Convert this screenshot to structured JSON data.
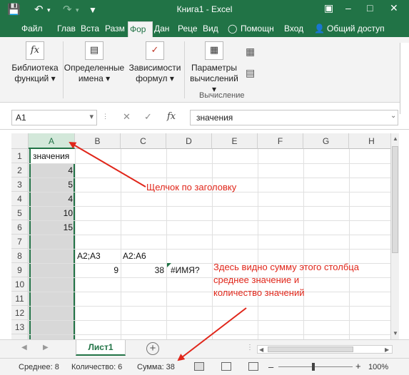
{
  "window": {
    "title": "Книга1 - Excel"
  },
  "tabs": [
    {
      "label": "Файл"
    },
    {
      "label": "Глав"
    },
    {
      "label": "Вста"
    },
    {
      "label": "Разм"
    },
    {
      "label": "Фор"
    },
    {
      "label": "Дан"
    },
    {
      "label": "Реце"
    },
    {
      "label": "Вид"
    }
  ],
  "help": {
    "label": "Помощн"
  },
  "login": {
    "label": "Вход"
  },
  "share": {
    "label": "Общий доступ"
  },
  "ribbon": {
    "lib_line1": "Библиотека",
    "lib_line2": "функций",
    "names_line1": "Определенные",
    "names_line2": "имена",
    "deps_line1": "Зависимости",
    "deps_line2": "формул",
    "calc_line1": "Параметры",
    "calc_line2": "вычислений",
    "calc_group": "Вычисление"
  },
  "formula_bar": {
    "name_box": "A1",
    "fx": "fx",
    "value": "значения"
  },
  "columns": [
    "A",
    "B",
    "C",
    "D",
    "E",
    "F",
    "G",
    "H"
  ],
  "rows": [
    "1",
    "2",
    "3",
    "4",
    "5",
    "6",
    "7",
    "8",
    "9",
    "10",
    "11",
    "12",
    "13"
  ],
  "cells": {
    "A1": "значения",
    "A2": "4",
    "A3": "5",
    "A4": "4",
    "A5": "10",
    "A6": "15",
    "B8": "A2;A3",
    "C8": "A2:A6",
    "B9": "9",
    "C9": "38",
    "D9": "#ИМЯ?"
  },
  "sheet": {
    "name": "Лист1",
    "add": "+"
  },
  "status": {
    "average": "Среднее: 8",
    "count": "Количество: 6",
    "sum": "Сумма: 38",
    "zoom": "100%"
  },
  "annotations": {
    "header_click": "Щелчок по заголовку",
    "status_line1": "Здесь видно сумму этого столбца",
    "status_line2": "среднее значение и",
    "status_line3": "количество значений"
  },
  "colors": {
    "excel_green": "#217346",
    "annotation_red": "#e0261a"
  }
}
